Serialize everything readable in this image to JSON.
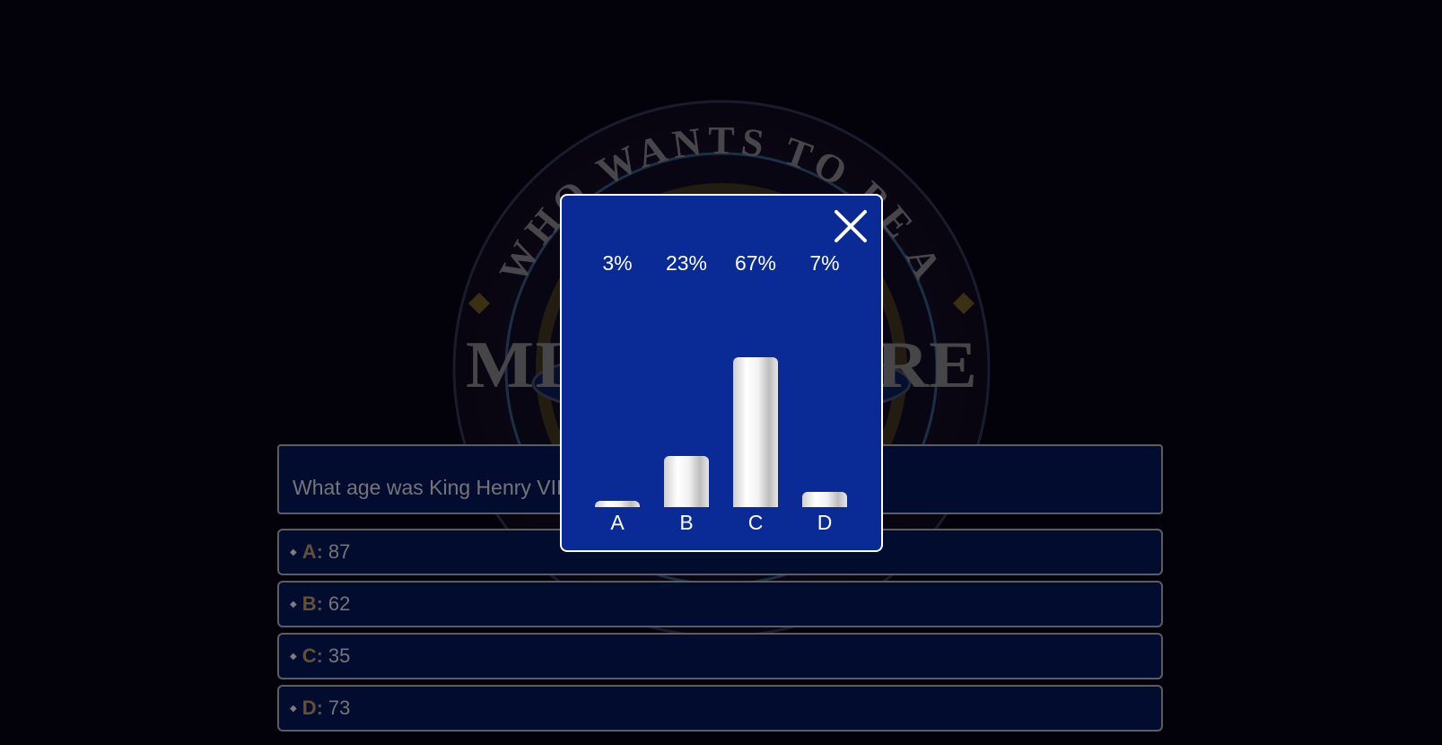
{
  "logo": {
    "top_text": "WHO WANTS TO BE A",
    "main_text": "MILLIONAIRE"
  },
  "question": {
    "text": "What age was King Henry VIII when he died?"
  },
  "answers": [
    {
      "letter": "A:",
      "value": "87"
    },
    {
      "letter": "B:",
      "value": "62"
    },
    {
      "letter": "C:",
      "value": "35"
    },
    {
      "letter": "D:",
      "value": "73"
    }
  ],
  "audience_poll": {
    "close_icon": "close-icon",
    "bar_color": "#e8e8e8",
    "panel_color": "#0a2a96"
  },
  "chart_data": {
    "type": "bar",
    "categories": [
      "A",
      "B",
      "C",
      "D"
    ],
    "values": [
      3,
      23,
      67,
      7
    ],
    "value_labels": [
      "3%",
      "23%",
      "67%",
      "7%"
    ],
    "ylim": [
      0,
      100
    ]
  }
}
